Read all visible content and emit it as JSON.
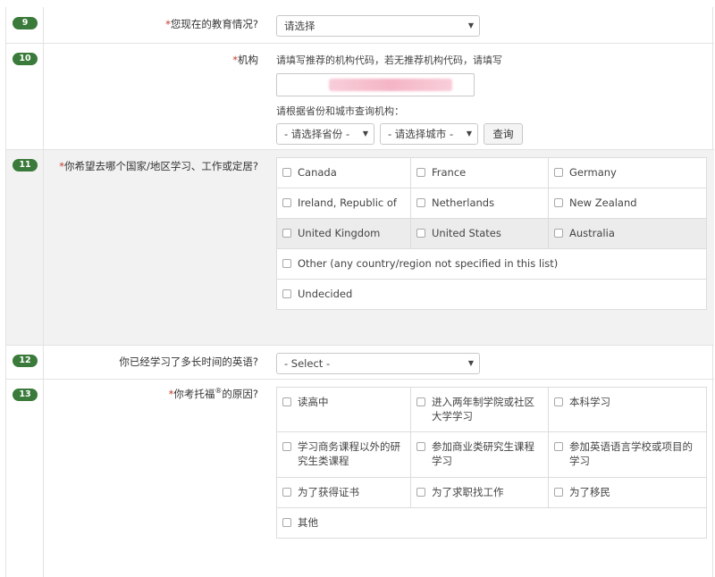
{
  "q9": {
    "number": "9",
    "label": "您现在的教育情况?",
    "required": "*",
    "select_value": "请选择"
  },
  "q10": {
    "number": "10",
    "label": "机构",
    "required": "*",
    "help": "请填写推荐的机构代码，若无推荐机构代码，请填写",
    "search_help": "请根据省份和城市查询机构：",
    "province_select": "- 请选择省份 -",
    "city_select": "- 请选择城市 -",
    "query_button": "查询"
  },
  "q11": {
    "number": "11",
    "label": "你希望去哪个国家/地区学习、工作或定居?",
    "required": "*",
    "options": [
      "Canada",
      "France",
      "Germany",
      "Ireland, Republic of",
      "Netherlands",
      "New Zealand",
      "United Kingdom",
      "United States",
      "Australia",
      "Other (any country/region not specified in this list)",
      "Undecided"
    ]
  },
  "q12": {
    "number": "12",
    "label": "你已经学习了多长时间的英语?",
    "select_value": "- Select -"
  },
  "q13": {
    "number": "13",
    "label_prefix": "你考托福",
    "label_sup": "®",
    "label_suffix": "的原因?",
    "required": "*",
    "options": [
      "读高中",
      "进入两年制学院或社区大学学习",
      "本科学习",
      "学习商务课程以外的研究生类课程",
      "参加商业类研究生课程学习",
      "参加英语语言学校或项目的学习",
      "为了获得证书",
      "为了求职找工作",
      "为了移民",
      "其他"
    ]
  },
  "colors": {
    "badge": "#3a7a3a",
    "required": "#c0392b",
    "shade": "#f2f2f2"
  },
  "icons": {
    "select_caret": "caret-down-icon",
    "checkbox": "checkbox-icon"
  }
}
